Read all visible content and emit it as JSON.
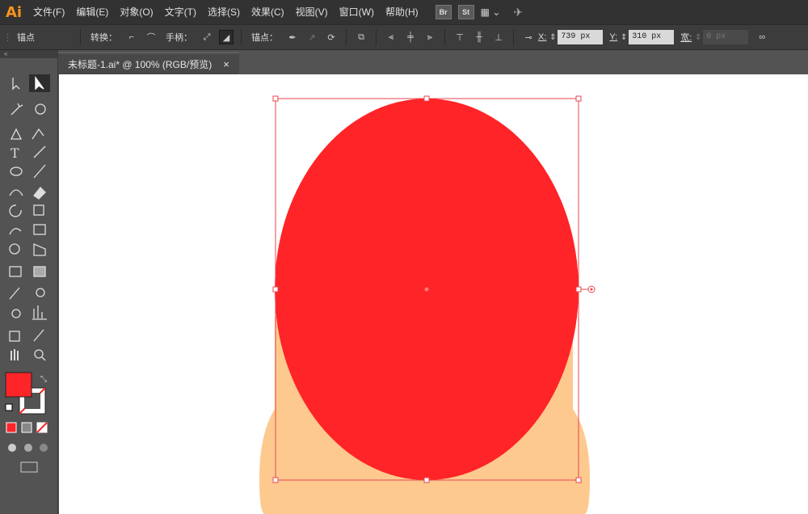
{
  "app": {
    "logo": "Ai"
  },
  "menu": {
    "items": [
      "文件(F)",
      "编辑(E)",
      "对象(O)",
      "文字(T)",
      "选择(S)",
      "效果(C)",
      "视图(V)",
      "窗口(W)",
      "帮助(H)"
    ],
    "bridge": "Br",
    "stock": "St"
  },
  "control": {
    "mode_label": "锚点",
    "convert_label": "转换：",
    "handles_label": "手柄：",
    "anchors_label": "锚点：",
    "x_label": "X:",
    "x_value": "739 px",
    "y_label": "Y:",
    "y_value": "310 px",
    "w_label": "宽:",
    "w_value": "0 px"
  },
  "document": {
    "tab_title": "未标题-1.ai* @ 100% (RGB/预览)",
    "close_glyph": "×"
  },
  "colors": {
    "fill": "#ff2427",
    "stroke": "none",
    "peach": "#fdc98e",
    "selection": "#e8464e"
  }
}
